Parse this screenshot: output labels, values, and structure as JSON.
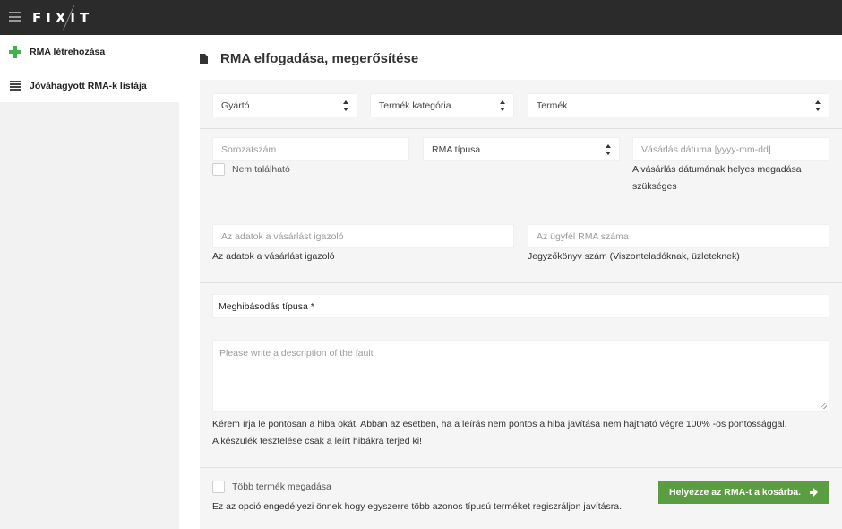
{
  "header": {
    "logo_text": "FIXIT"
  },
  "sidebar": {
    "items": [
      {
        "label": "RMA létrehozása",
        "icon": "plus-icon"
      },
      {
        "label": "Jóváhagyott RMA-k listája",
        "icon": "list-icon"
      }
    ]
  },
  "page": {
    "title": "RMA elfogadása, megerősítése",
    "icon": "document-icon"
  },
  "form": {
    "manufacturer": "Gyártó",
    "product_category": "Termék kategória",
    "product": "Termék",
    "serial_placeholder": "Sorozatszám",
    "not_found_label": "Nem található",
    "rma_type": "RMA típusa",
    "purchase_date_placeholder": "Vásárlás dátuma [yyyy-mm-dd]",
    "purchase_date_help_1": "A vásárlás dátumának helyes megadása",
    "purchase_date_help_2": "szükséges",
    "proof_placeholder": "Az adatok a vásárlást igazoló",
    "proof_label": "Az adatok a vásárlást igazoló",
    "customer_rma_placeholder": "Az ügyfél RMA száma",
    "customer_rma_label": "Jegyzőkönyv szám (Viszonteladóknak, üzleteknek)",
    "fault_type_label": "Meghibásodás típusa *",
    "description_placeholder": "Please write a description of the fault",
    "description_help_1": "Kérem írja le pontosan a hiba okát. Abban az esetben, ha a leírás nem pontos a hiba javítása nem hajtható végre 100% -os pontossággal.",
    "description_help_2": "A készülék tesztelése csak a leírt hibákra terjed ki!",
    "multi_product_label": "Több termék megadása",
    "multi_product_help": "Ez az opció engedélyezi önnek hogy egyszerre több azonos típusú terméket regiszráljon javításra.",
    "submit_label": "Helyezze az RMA-t a kosárba."
  },
  "colors": {
    "topbar": "#2b2b2b",
    "accent_green": "#5b9e42",
    "plus_green": "#3bb54a"
  }
}
